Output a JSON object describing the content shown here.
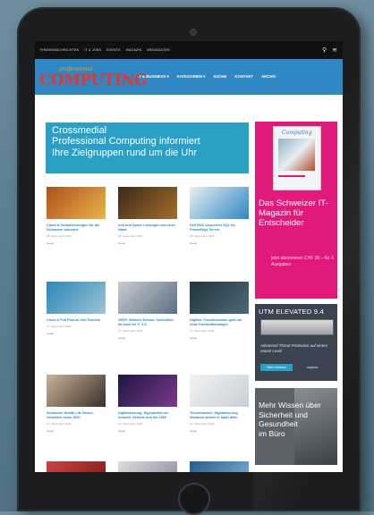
{
  "topbar": {
    "links": [
      "FIRMENNACHRICHTEN",
      "IT & JOBS",
      "EVENTS",
      "MAGAZIN",
      "MEDIADATEN"
    ],
    "icons": [
      "search-icon",
      "rss-icon"
    ]
  },
  "header": {
    "logo_prefix": "professional",
    "logo_main": "COMPUTING",
    "nav": [
      "IT & BUSINESS ▾",
      "KATEGORIEN ▾",
      "SUCHE",
      "KONTAKT",
      "ARCHIV"
    ]
  },
  "banner": {
    "line1": "Crossmedial",
    "line2": "Professional Computing informiert",
    "line3": "Ihre Zielgruppen rund um die Uhr"
  },
  "articles": [
    {
      "title": "Cloud & Virtualisierungen für die Schweizer Industrie",
      "date": "28. September 2018",
      "more": "Lesen",
      "colors": [
        "#b0501e",
        "#e8b44a"
      ]
    },
    {
      "title": "und und Spiele Lösungen aus einer Hand",
      "date": "28. September 2018",
      "more": "Lesen",
      "colors": [
        "#3b2a1a",
        "#a56d2b"
      ]
    },
    {
      "title": "Dell EMC kooperiert SQL für PowerEdge Server",
      "date": "28. September 2018",
      "more": "Lesen",
      "colors": [
        "#e9eef2",
        "#2f87c3"
      ]
    },
    {
      "title": "Cisco & Full Plan an den Schulen",
      "date": "27. September 2018",
      "more": "Lesen",
      "colors": [
        "#2a87b8",
        "#9fc4d6"
      ]
    },
    {
      "title": "ZEKF: Welsers Schutz: Innovation ist auch für IT 4 S.",
      "date": "27. September 2018",
      "more": "Lesen",
      "colors": [
        "#c9ccd0",
        "#5b6f82"
      ]
    },
    {
      "title": "Digitale Transformation geht um ohne Fachkräftemangel",
      "date": "27. September 2018",
      "more": "Lesen",
      "colors": [
        "#23343d",
        "#4d6a78"
      ]
    },
    {
      "title": "Schweizer Health Life Nexus, Gestalten neuer SDD",
      "date": "26. September 2018",
      "more": "Lesen",
      "colors": [
        "#c9b39a",
        "#3a2f28"
      ]
    },
    {
      "title": "Digitalisierung: Eigenarbeit der Zukunft. Deloitte und die 1000",
      "date": "26. September 2018",
      "more": "Lesen",
      "colors": [
        "#1d1640",
        "#7a3a8c"
      ]
    },
    {
      "title": "Termintracker: Digitalisierung Wokaron wollen in SaaS aktiv",
      "date": "26. September 2018",
      "more": "Lesen",
      "colors": [
        "#f2f2f2",
        "#c8d0d6"
      ]
    }
  ],
  "sidebar": {
    "ad1": {
      "mag_title": "Computing",
      "headline": "Das Schweizer IT-Magazin für Entscheider",
      "sub": "jetzt abonnieren CHF 36.– für 4 Ausgaben"
    },
    "ad2": {
      "title": "UTM ELEVATED 9.4",
      "tagline": "Advanced Threat Protection auf einem neuen Level",
      "button": "Mehr erfahren",
      "brand": "sophos"
    },
    "ad3": {
      "lines": [
        "Mehr Wissen über",
        "Sicherheit und",
        "Gesundheit",
        "im Büro"
      ]
    }
  },
  "colors": {
    "header_blue": "#2f87c3",
    "banner_teal": "#2aa0c6",
    "ad_pink": "#e0197a",
    "logo_red": "#e8342a"
  }
}
